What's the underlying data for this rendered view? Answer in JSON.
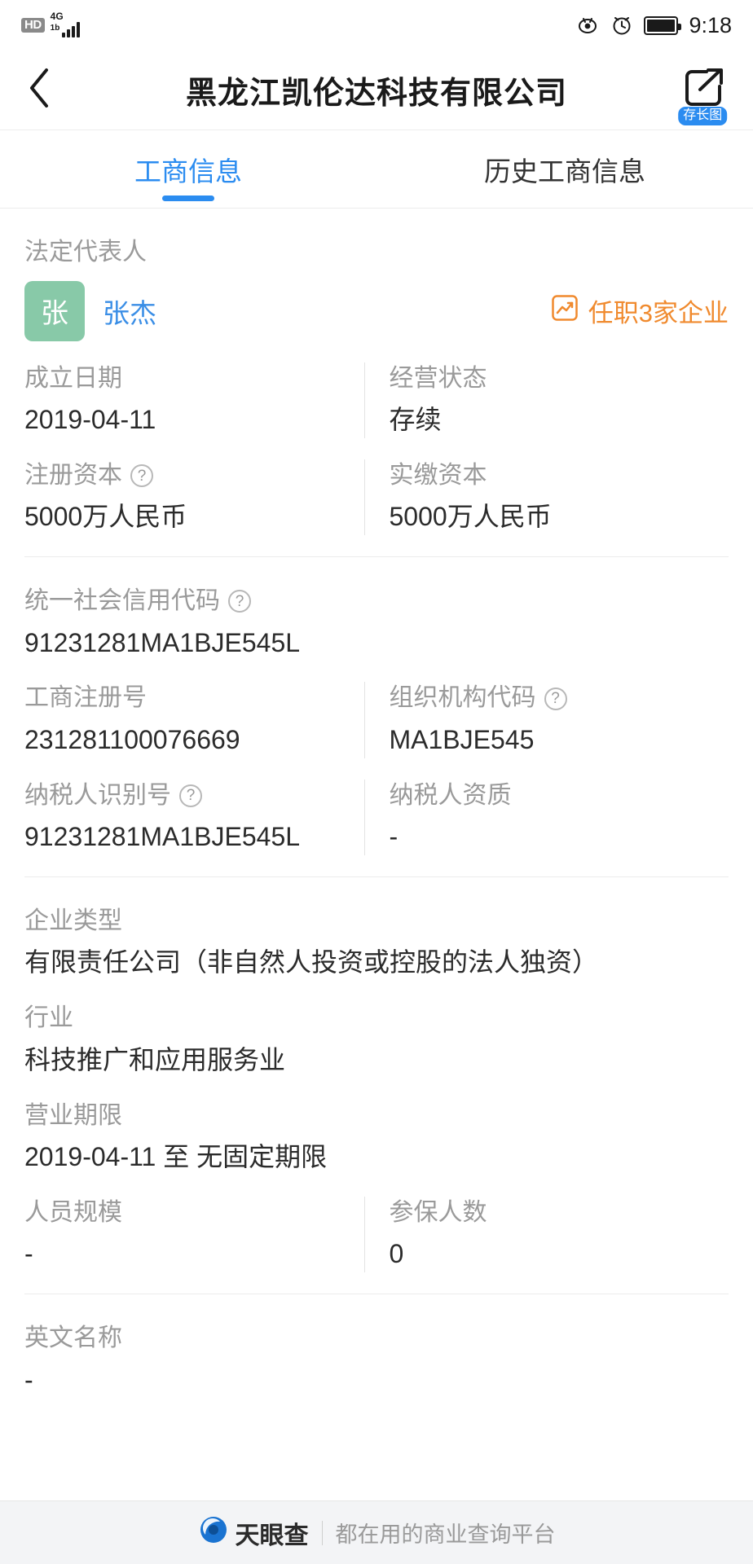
{
  "status_bar": {
    "hd_label": "HD",
    "network_type": "4G",
    "network_sub": "1b",
    "time": "9:18",
    "icons": [
      "eye-icon",
      "alarm-icon",
      "battery-icon"
    ]
  },
  "nav": {
    "back_icon": "chevron-left-icon",
    "title": "黑龙江凯伦达科技有限公司",
    "share_icon": "share-external-icon",
    "share_badge": "存长图"
  },
  "tabs": [
    {
      "label": "工商信息",
      "active": true
    },
    {
      "label": "历史工商信息",
      "active": false
    }
  ],
  "legal_rep": {
    "label": "法定代表人",
    "avatar_initial": "张",
    "avatar_color": "#88c9a8",
    "name": "张杰",
    "name_color": "#3a8ee6",
    "link_text": "任职3家企业",
    "link_color": "#f08a2e",
    "link_icon": "chart-box-icon"
  },
  "rows": {
    "found_date": {
      "label": "成立日期",
      "value": "2019-04-11"
    },
    "status": {
      "label": "经营状态",
      "value": "存续"
    },
    "reg_capital": {
      "label": "注册资本",
      "value": "5000万人民币",
      "help": true
    },
    "paid_capital": {
      "label": "实缴资本",
      "value": "5000万人民币"
    },
    "credit_code": {
      "label": "统一社会信用代码",
      "value": "91231281MA1BJE545L",
      "help": true
    },
    "reg_number": {
      "label": "工商注册号",
      "value": "231281100076669"
    },
    "org_code": {
      "label": "组织机构代码",
      "value": "MA1BJE545",
      "help": true
    },
    "taxpayer_id": {
      "label": "纳税人识别号",
      "value": "91231281MA1BJE545L",
      "help": true
    },
    "taxpayer_type": {
      "label": "纳税人资质",
      "value": "-"
    },
    "company_type": {
      "label": "企业类型",
      "value": "有限责任公司（非自然人投资或控股的法人独资）"
    },
    "industry": {
      "label": "行业",
      "value": "科技推广和应用服务业"
    },
    "business_term": {
      "label": "营业期限",
      "value": "2019-04-11 至 无固定期限"
    },
    "staff_size": {
      "label": "人员规模",
      "value": "-"
    },
    "insured_count": {
      "label": "参保人数",
      "value": "0"
    },
    "english_name": {
      "label": "英文名称",
      "value": "-"
    }
  },
  "footer": {
    "logo_icon": "tianyancha-logo-icon",
    "brand": "天眼查",
    "slogan": "都在用的商业查询平台"
  },
  "colors": {
    "accent_blue": "#2b8cf0",
    "link_blue": "#3a8ee6",
    "orange": "#f08a2e",
    "avatar_green": "#88c9a8",
    "label_gray": "#9a9a9a",
    "value_dark": "#2b2b2b"
  }
}
